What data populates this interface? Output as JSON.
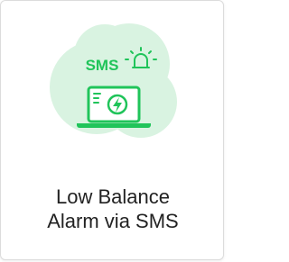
{
  "card": {
    "badge_text": "SMS",
    "title_line1": "Low Balance",
    "title_line2": "Alarm via SMS"
  },
  "icons": {
    "alarm": "siren-icon",
    "device": "laptop-icon",
    "power": "lightning-icon"
  },
  "colors": {
    "accent": "#20c45a",
    "blob": "#d9f3e1",
    "text": "#222222"
  }
}
